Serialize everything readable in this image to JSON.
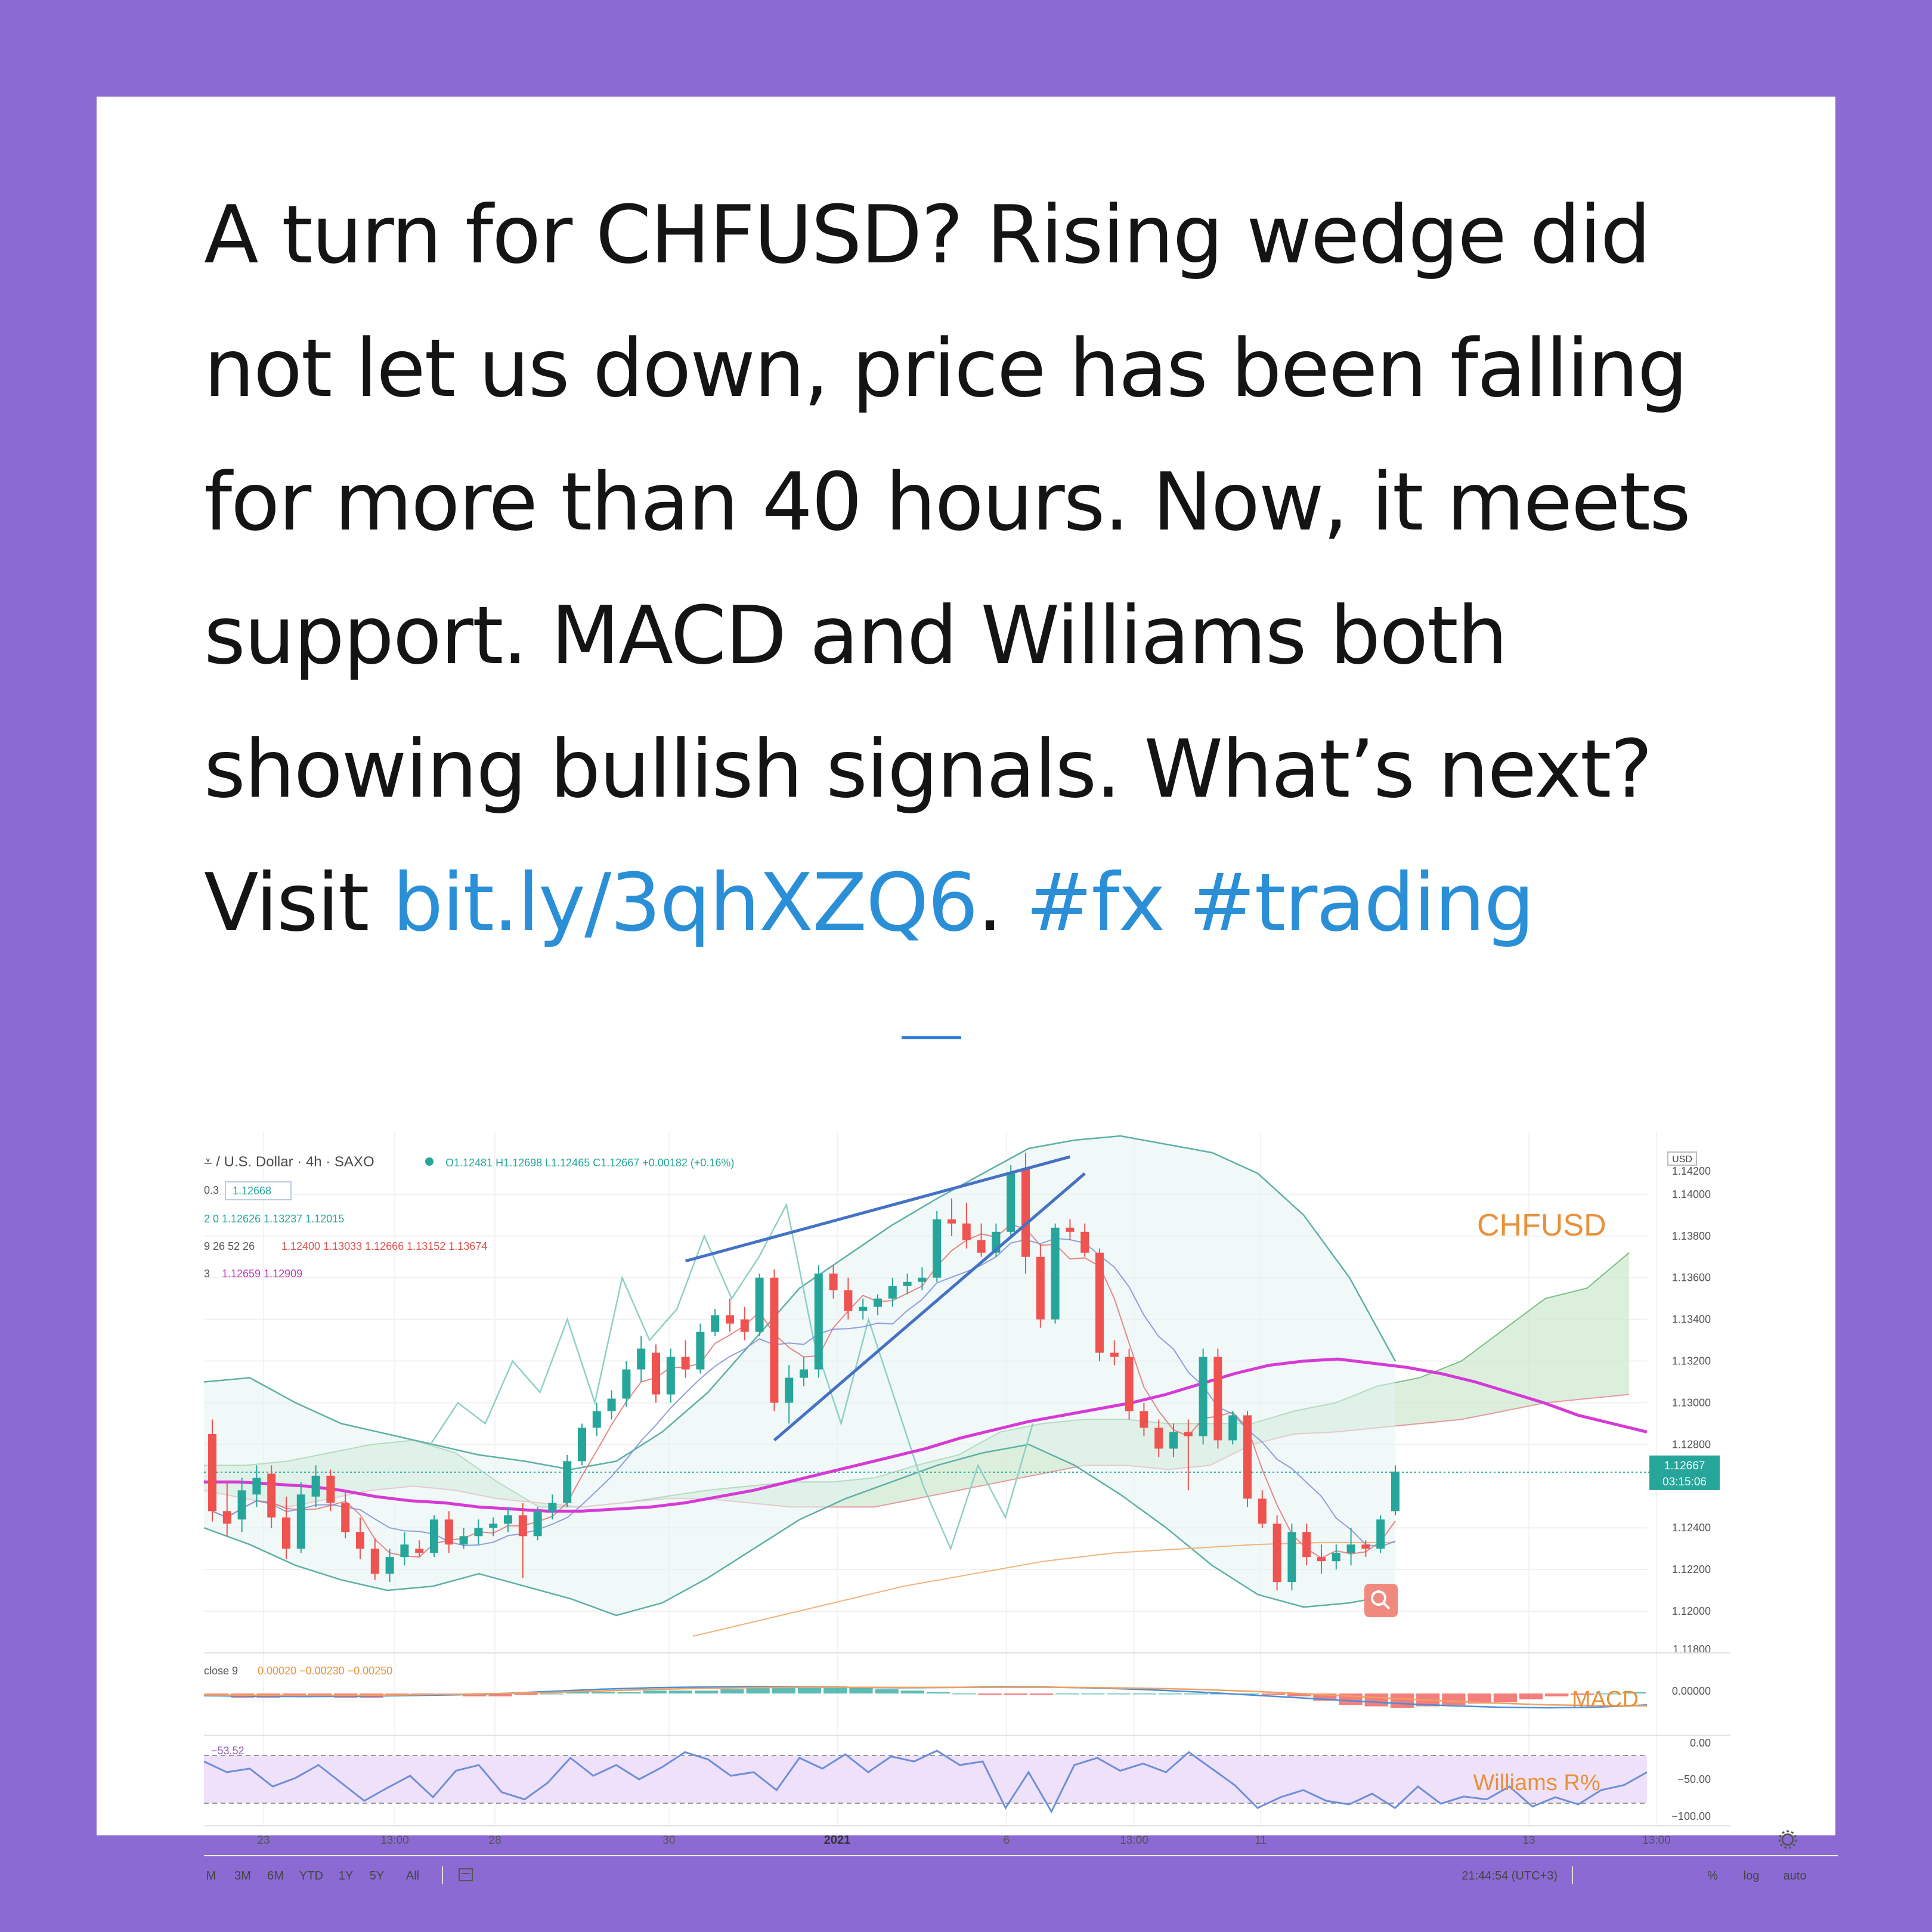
{
  "tweet": {
    "line1": "A turn for CHFUSD? Rising wedge did",
    "line2": "not let us down, price has been falling",
    "line3": "for more than 40 hours. Now, it meets",
    "line4": "support. MACD and Williams both",
    "line5": "showing bullish signals. What’s next?",
    "visit": "Visit ",
    "link": "bit.ly/3qhXZQ6",
    "dot": ". ",
    "tag1": "#fx",
    "space": " ",
    "tag2": "#trading"
  },
  "colors": {
    "background": "#8b6bd3",
    "link": "#2a8fd6",
    "bull": "#26a69a",
    "bear": "#ef5350",
    "ma_slow": "#d63ad6",
    "channel": "#4472c4",
    "overlay_label": "#e8913a",
    "williams_band": "#e9d8f5",
    "cloud": "#cde8cf"
  },
  "header": {
    "symbol": "⩡ / U.S. Dollar · 4h · SAXO",
    "ohlc": "O1.12481 H1.12698 L1.12465 C1.12667 +0.00182 (+0.16%)",
    "row1_prefix": "0.3",
    "row1_value": "1.12668",
    "row2": "2 0  1.12626  1.13237  1.12015",
    "row3_prefix": "9 26 52 26",
    "row3_values": "1.12400  1.13033  1.12666  1.13152  1.13674",
    "row4_prefix": "3",
    "row4_values": "1.12659  1.12909"
  },
  "price_axis": {
    "currency": "USD",
    "top_cut": "1.14200",
    "ticks": [
      "1.14000",
      "1.13800",
      "1.13600",
      "1.13400",
      "1.13200",
      "1.13000",
      "1.12800",
      "1.12400",
      "1.12200",
      "1.12000"
    ],
    "bottom_cut": "1.11800",
    "last_price": "1.12667",
    "countdown": "03:15:06"
  },
  "labels": {
    "pair": "CHFUSD",
    "macd": "MACD",
    "williams": "Williams R%"
  },
  "macd_legend": {
    "prefix": "close 9",
    "values": "0.00020  −0.00230  −0.00250"
  },
  "macd_axis": {
    "zero": "0.00000"
  },
  "williams_legend": {
    "value": "−53.52"
  },
  "williams_axis": {
    "top": "0.00",
    "mid": "−50.00",
    "bottom": "−100.00"
  },
  "time_axis": [
    "23",
    "13:00",
    "28",
    "30",
    "2021",
    "6",
    "13:00",
    "11",
    "13",
    "13:00"
  ],
  "bottom_bar": {
    "ranges": [
      "M",
      "3M",
      "6M",
      "YTD",
      "1Y",
      "5Y",
      "All"
    ],
    "clock": "21:44:54 (UTC+3)",
    "percent": "%",
    "log": "log",
    "auto": "auto"
  },
  "chart_data": {
    "type": "candlestick",
    "title": "CHFUSD",
    "timeframe": "4h",
    "y_range": [
      1.118,
      1.143
    ],
    "candles": [
      {
        "o": 1.1285,
        "h": 1.1292,
        "l": 1.1243,
        "c": 1.1248
      },
      {
        "o": 1.1248,
        "h": 1.1262,
        "l": 1.1236,
        "c": 1.1242
      },
      {
        "o": 1.1244,
        "h": 1.1264,
        "l": 1.1238,
        "c": 1.1258
      },
      {
        "o": 1.1256,
        "h": 1.127,
        "l": 1.125,
        "c": 1.1264
      },
      {
        "o": 1.1266,
        "h": 1.127,
        "l": 1.124,
        "c": 1.1245
      },
      {
        "o": 1.1245,
        "h": 1.1255,
        "l": 1.1225,
        "c": 1.123
      },
      {
        "o": 1.123,
        "h": 1.1262,
        "l": 1.1228,
        "c": 1.1256
      },
      {
        "o": 1.1255,
        "h": 1.127,
        "l": 1.125,
        "c": 1.1265
      },
      {
        "o": 1.1265,
        "h": 1.1268,
        "l": 1.1248,
        "c": 1.1252
      },
      {
        "o": 1.1252,
        "h": 1.1258,
        "l": 1.1235,
        "c": 1.1238
      },
      {
        "o": 1.1238,
        "h": 1.1245,
        "l": 1.1225,
        "c": 1.123
      },
      {
        "o": 1.123,
        "h": 1.1235,
        "l": 1.1215,
        "c": 1.1218
      },
      {
        "o": 1.1218,
        "h": 1.123,
        "l": 1.1214,
        "c": 1.1226
      },
      {
        "o": 1.1226,
        "h": 1.1238,
        "l": 1.1222,
        "c": 1.1232
      },
      {
        "o": 1.123,
        "h": 1.1234,
        "l": 1.1226,
        "c": 1.1228
      },
      {
        "o": 1.1228,
        "h": 1.1246,
        "l": 1.1226,
        "c": 1.1244
      },
      {
        "o": 1.1244,
        "h": 1.1248,
        "l": 1.1228,
        "c": 1.1232
      },
      {
        "o": 1.1232,
        "h": 1.124,
        "l": 1.123,
        "c": 1.1236
      },
      {
        "o": 1.1236,
        "h": 1.1244,
        "l": 1.1232,
        "c": 1.124
      },
      {
        "o": 1.124,
        "h": 1.1245,
        "l": 1.1236,
        "c": 1.1242
      },
      {
        "o": 1.1242,
        "h": 1.125,
        "l": 1.1238,
        "c": 1.1246
      },
      {
        "o": 1.1246,
        "h": 1.1252,
        "l": 1.1216,
        "c": 1.1236
      },
      {
        "o": 1.1236,
        "h": 1.125,
        "l": 1.1234,
        "c": 1.1248
      },
      {
        "o": 1.1248,
        "h": 1.1256,
        "l": 1.1244,
        "c": 1.1252
      },
      {
        "o": 1.1252,
        "h": 1.1275,
        "l": 1.125,
        "c": 1.1272
      },
      {
        "o": 1.1272,
        "h": 1.129,
        "l": 1.127,
        "c": 1.1288
      },
      {
        "o": 1.1288,
        "h": 1.13,
        "l": 1.1284,
        "c": 1.1296
      },
      {
        "o": 1.1296,
        "h": 1.1306,
        "l": 1.1292,
        "c": 1.1302
      },
      {
        "o": 1.1302,
        "h": 1.132,
        "l": 1.1298,
        "c": 1.1316
      },
      {
        "o": 1.1316,
        "h": 1.1332,
        "l": 1.131,
        "c": 1.1326
      },
      {
        "o": 1.1324,
        "h": 1.1328,
        "l": 1.13,
        "c": 1.1304
      },
      {
        "o": 1.1304,
        "h": 1.1326,
        "l": 1.13,
        "c": 1.1322
      },
      {
        "o": 1.1322,
        "h": 1.133,
        "l": 1.1312,
        "c": 1.1316
      },
      {
        "o": 1.1316,
        "h": 1.1338,
        "l": 1.1314,
        "c": 1.1334
      },
      {
        "o": 1.1334,
        "h": 1.1345,
        "l": 1.1332,
        "c": 1.1342
      },
      {
        "o": 1.1342,
        "h": 1.135,
        "l": 1.1334,
        "c": 1.1338
      },
      {
        "o": 1.134,
        "h": 1.1346,
        "l": 1.133,
        "c": 1.1334
      },
      {
        "o": 1.1334,
        "h": 1.1362,
        "l": 1.1332,
        "c": 1.136
      },
      {
        "o": 1.136,
        "h": 1.1364,
        "l": 1.1296,
        "c": 1.13
      },
      {
        "o": 1.13,
        "h": 1.1318,
        "l": 1.129,
        "c": 1.1312
      },
      {
        "o": 1.1312,
        "h": 1.1322,
        "l": 1.1308,
        "c": 1.1316
      },
      {
        "o": 1.1316,
        "h": 1.1366,
        "l": 1.1312,
        "c": 1.1362
      },
      {
        "o": 1.1362,
        "h": 1.1366,
        "l": 1.135,
        "c": 1.1354
      },
      {
        "o": 1.1354,
        "h": 1.136,
        "l": 1.134,
        "c": 1.1344
      },
      {
        "o": 1.1344,
        "h": 1.135,
        "l": 1.134,
        "c": 1.1346
      },
      {
        "o": 1.1346,
        "h": 1.1352,
        "l": 1.1342,
        "c": 1.135
      },
      {
        "o": 1.135,
        "h": 1.136,
        "l": 1.1346,
        "c": 1.1356
      },
      {
        "o": 1.1356,
        "h": 1.1362,
        "l": 1.1352,
        "c": 1.1358
      },
      {
        "o": 1.1358,
        "h": 1.1365,
        "l": 1.1354,
        "c": 1.136
      },
      {
        "o": 1.136,
        "h": 1.1392,
        "l": 1.1358,
        "c": 1.1388
      },
      {
        "o": 1.1388,
        "h": 1.1398,
        "l": 1.138,
        "c": 1.1386
      },
      {
        "o": 1.1386,
        "h": 1.1396,
        "l": 1.1374,
        "c": 1.1378
      },
      {
        "o": 1.1378,
        "h": 1.1386,
        "l": 1.137,
        "c": 1.1372
      },
      {
        "o": 1.1372,
        "h": 1.1386,
        "l": 1.137,
        "c": 1.1382
      },
      {
        "o": 1.1382,
        "h": 1.1414,
        "l": 1.138,
        "c": 1.141
      },
      {
        "o": 1.1412,
        "h": 1.142,
        "l": 1.1362,
        "c": 1.137
      },
      {
        "o": 1.137,
        "h": 1.1376,
        "l": 1.1336,
        "c": 1.134
      },
      {
        "o": 1.134,
        "h": 1.1386,
        "l": 1.1338,
        "c": 1.1384
      },
      {
        "o": 1.1384,
        "h": 1.1388,
        "l": 1.1378,
        "c": 1.1382
      },
      {
        "o": 1.1382,
        "h": 1.1386,
        "l": 1.137,
        "c": 1.1372
      },
      {
        "o": 1.1372,
        "h": 1.1374,
        "l": 1.132,
        "c": 1.1324
      },
      {
        "o": 1.1324,
        "h": 1.133,
        "l": 1.1318,
        "c": 1.1322
      },
      {
        "o": 1.1322,
        "h": 1.1326,
        "l": 1.1292,
        "c": 1.1296
      },
      {
        "o": 1.1296,
        "h": 1.13,
        "l": 1.1284,
        "c": 1.1288
      },
      {
        "o": 1.1288,
        "h": 1.1292,
        "l": 1.1274,
        "c": 1.1278
      },
      {
        "o": 1.1278,
        "h": 1.129,
        "l": 1.1274,
        "c": 1.1286
      },
      {
        "o": 1.1286,
        "h": 1.1292,
        "l": 1.1258,
        "c": 1.1284
      },
      {
        "o": 1.1284,
        "h": 1.1326,
        "l": 1.128,
        "c": 1.1322
      },
      {
        "o": 1.1322,
        "h": 1.1326,
        "l": 1.1278,
        "c": 1.1282
      },
      {
        "o": 1.1282,
        "h": 1.1296,
        "l": 1.128,
        "c": 1.1294
      },
      {
        "o": 1.1294,
        "h": 1.1296,
        "l": 1.125,
        "c": 1.1254
      },
      {
        "o": 1.1254,
        "h": 1.1258,
        "l": 1.124,
        "c": 1.1242
      },
      {
        "o": 1.1242,
        "h": 1.1246,
        "l": 1.121,
        "c": 1.1214
      },
      {
        "o": 1.1214,
        "h": 1.1242,
        "l": 1.121,
        "c": 1.1238
      },
      {
        "o": 1.1238,
        "h": 1.1242,
        "l": 1.1222,
        "c": 1.1226
      },
      {
        "o": 1.1226,
        "h": 1.1232,
        "l": 1.1218,
        "c": 1.1224
      },
      {
        "o": 1.1224,
        "h": 1.1232,
        "l": 1.122,
        "c": 1.1228
      },
      {
        "o": 1.1228,
        "h": 1.124,
        "l": 1.1222,
        "c": 1.1232
      },
      {
        "o": 1.1232,
        "h": 1.1234,
        "l": 1.1226,
        "c": 1.123
      },
      {
        "o": 1.123,
        "h": 1.1246,
        "l": 1.1228,
        "c": 1.1244
      },
      {
        "o": 1.1248,
        "h": 1.127,
        "l": 1.1246,
        "c": 1.1267
      }
    ],
    "ma_slow": [
      1.1262,
      1.1262,
      1.1261,
      1.126,
      1.1258,
      1.1255,
      1.1253,
      1.1252,
      1.125,
      1.1249,
      1.1248,
      1.1248,
      1.1249,
      1.125,
      1.1252,
      1.1255,
      1.1258,
      1.1262,
      1.1266,
      1.127,
      1.1274,
      1.1278,
      1.1283,
      1.1287,
      1.1291,
      1.1294,
      1.1297,
      1.13,
      1.1304,
      1.1309,
      1.1314,
      1.1318,
      1.132,
      1.1321,
      1.1319,
      1.1317,
      1.1314,
      1.131,
      1.1305,
      1.13,
      1.1294,
      1.129,
      1.1286
    ],
    "cloud_a": [
      1.127,
      1.127,
      1.1272,
      1.1276,
      1.128,
      1.1282,
      1.1276,
      1.1262,
      1.125,
      1.125,
      1.1252,
      1.1255,
      1.1258,
      1.126,
      1.1262,
      1.1262,
      1.1264,
      1.127,
      1.1275,
      1.1286,
      1.129,
      1.1292,
      1.1292,
      1.129,
      1.129,
      1.129,
      1.1296,
      1.13,
      1.1308,
      1.1312,
      1.132,
      1.1335,
      1.135,
      1.1355,
      1.1372
    ],
    "cloud_b": [
      1.1258,
      1.1254,
      1.125,
      1.1254,
      1.1258,
      1.126,
      1.1258,
      1.1254,
      1.1252,
      1.125,
      1.1252,
      1.1254,
      1.1254,
      1.1252,
      1.125,
      1.125,
      1.125,
      1.1254,
      1.1258,
      1.1262,
      1.1266,
      1.127,
      1.127,
      1.1268,
      1.127,
      1.128,
      1.1285,
      1.1286,
      1.1288,
      1.129,
      1.1292,
      1.1296,
      1.13,
      1.1302,
      1.1304
    ],
    "bb_upper": [
      1.131,
      1.1312,
      1.13,
      1.129,
      1.1285,
      1.128,
      1.1275,
      1.1272,
      1.1268,
      1.1272,
      1.1286,
      1.1305,
      1.133,
      1.1355,
      1.137,
      1.1385,
      1.1398,
      1.141,
      1.1422,
      1.1426,
      1.1428,
      1.1424,
      1.142,
      1.141,
      1.139,
      1.136,
      1.132
    ],
    "bb_lower": [
      1.124,
      1.1232,
      1.1222,
      1.1215,
      1.121,
      1.1212,
      1.1218,
      1.1212,
      1.1206,
      1.1198,
      1.1204,
      1.1216,
      1.123,
      1.1244,
      1.1254,
      1.1262,
      1.127,
      1.1276,
      1.128,
      1.127,
      1.1256,
      1.124,
      1.1222,
      1.1208,
      1.1202,
      1.1204,
      1.1208
    ],
    "lagging_line": [
      1.128,
      1.13,
      1.129,
      1.132,
      1.1305,
      1.134,
      1.13,
      1.136,
      1.133,
      1.1345,
      1.138,
      1.135,
      1.137,
      1.1395,
      1.133,
      1.129,
      1.134,
      1.13,
      1.126,
      1.123,
      1.127,
      1.1245,
      1.129
    ],
    "long_ma": [
      1.1188,
      1.1196,
      1.1204,
      1.1212,
      1.1218,
      1.1224,
      1.1228,
      1.123,
      1.1232,
      1.1233,
      1.1233
    ],
    "wedge_upper": [
      [
        32,
        1.1368
      ],
      [
        58,
        1.1418
      ]
    ],
    "wedge_lower": [
      [
        38,
        1.1282
      ],
      [
        59,
        1.141
      ]
    ],
    "macd": {
      "histogram": [
        -2,
        -3,
        -3,
        -2,
        -2,
        -3,
        -3,
        -1,
        -1,
        -1,
        -2,
        -2,
        -1,
        0,
        1,
        1,
        1,
        2,
        2,
        2,
        3,
        4,
        5,
        5,
        5,
        4,
        3,
        2,
        1,
        0,
        -1,
        -1,
        -1,
        0,
        0,
        0,
        0,
        0,
        0,
        0,
        0,
        -1,
        -2,
        -5,
        -8,
        -9,
        -10,
        -9,
        -8,
        -7,
        -6,
        -4,
        -2,
        -1,
        0,
        1
      ],
      "macd_line": [
        -1.5,
        -2,
        -2.2,
        -2,
        -1.5,
        -1,
        0,
        1.5,
        3,
        4,
        4.5,
        4.8,
        4.6,
        4.2,
        4,
        4.2,
        4.6,
        4.4,
        3.8,
        2.6,
        1,
        -1,
        -3,
        -5,
        -7,
        -8.5,
        -9.6,
        -10,
        -9.6,
        -8
      ],
      "signal_line": [
        -1,
        -1.2,
        -1.4,
        -1.3,
        -1,
        -0.6,
        0,
        0.8,
        1.8,
        2.8,
        3.6,
        4.1,
        4.3,
        4.3,
        4.2,
        4.2,
        4.3,
        4.3,
        4.1,
        3.6,
        2.8,
        1.6,
        0,
        -1.8,
        -3.6,
        -5.3,
        -6.8,
        -7.9,
        -8.5,
        -8.6
      ]
    },
    "williams_r": [
      -25,
      -40,
      -35,
      -60,
      -48,
      -30,
      -55,
      -80,
      -62,
      -45,
      -75,
      -38,
      -30,
      -68,
      -78,
      -55,
      -20,
      -45,
      -30,
      -50,
      -33,
      -12,
      -22,
      -45,
      -40,
      -65,
      -20,
      -35,
      -15,
      -40,
      -18,
      -25,
      -10,
      -30,
      -25,
      -90,
      -40,
      -95,
      -30,
      -20,
      -38,
      -28,
      -40,
      -12,
      -35,
      -58,
      -90,
      -75,
      -65,
      -80,
      -85,
      -70,
      -90,
      -60,
      -84,
      -74,
      -78,
      -60,
      -88,
      -75,
      -85,
      -65,
      -58,
      -40
    ]
  }
}
